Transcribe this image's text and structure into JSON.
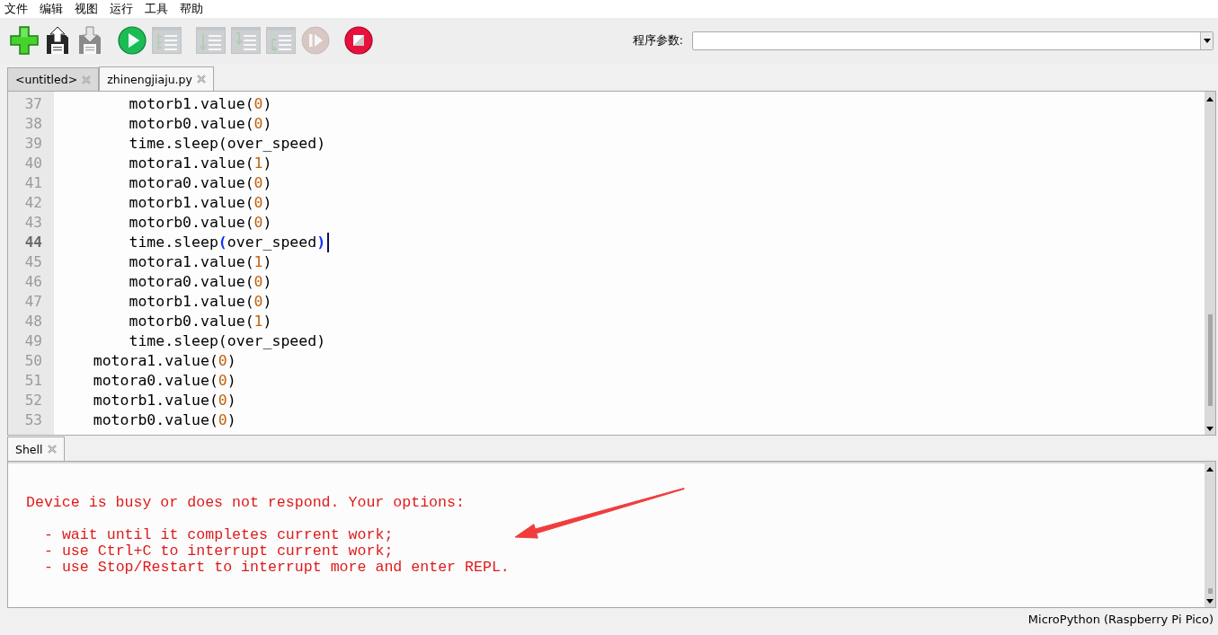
{
  "menu": [
    "文件",
    "编辑",
    "视图",
    "运行",
    "工具",
    "帮助"
  ],
  "toolbar": {
    "buttons": [
      {
        "kind": "new",
        "disabled": false
      },
      {
        "kind": "load",
        "disabled": false
      },
      {
        "kind": "save",
        "disabled": true
      },
      {
        "kind": "run",
        "disabled": false
      },
      {
        "kind": "debug",
        "disabled": true
      },
      {
        "kind": "step_over",
        "disabled": true
      },
      {
        "kind": "step_into",
        "disabled": true
      },
      {
        "kind": "step_out",
        "disabled": true
      },
      {
        "kind": "resume",
        "disabled": true
      },
      {
        "kind": "stop",
        "disabled": false
      }
    ],
    "program_args": {
      "label": "程序参数:"
    }
  },
  "editor_tabs": [
    {
      "label": "<untitled>",
      "selected": false
    },
    {
      "label": "zhinengjiaju.py",
      "selected": true
    }
  ],
  "editor": {
    "lines": [
      {
        "number": "37",
        "code": "        motorb1.value(0)",
        "current": false
      },
      {
        "number": "38",
        "code": "        motorb0.value(0)",
        "current": false
      },
      {
        "number": "39",
        "code": "        time.sleep(over_speed)",
        "current": false
      },
      {
        "number": "40",
        "code": "        motora1.value(1)",
        "current": false
      },
      {
        "number": "41",
        "code": "        motora0.value(0)",
        "current": false
      },
      {
        "number": "42",
        "code": "        motorb1.value(0)",
        "current": false
      },
      {
        "number": "43",
        "code": "        motorb0.value(0)",
        "current": false
      },
      {
        "number": "44",
        "code": "        time.sleep(over_speed)",
        "current": true
      },
      {
        "number": "45",
        "code": "        motora1.value(1)",
        "current": false
      },
      {
        "number": "46",
        "code": "        motora0.value(0)",
        "current": false
      },
      {
        "number": "47",
        "code": "        motorb1.value(0)",
        "current": false
      },
      {
        "number": "48",
        "code": "        motorb0.value(1)",
        "current": false
      },
      {
        "number": "49",
        "code": "        time.sleep(over_speed)",
        "current": false
      },
      {
        "number": "50",
        "code": "    motora1.value(0)",
        "current": false
      },
      {
        "number": "51",
        "code": "    motora0.value(0)",
        "current": false
      },
      {
        "number": "52",
        "code": "    motorb1.value(0)",
        "current": false
      },
      {
        "number": "53",
        "code": "    motorb0.value(0)",
        "current": false
      }
    ]
  },
  "shell": {
    "tab": {
      "label": "Shell",
      "selected": true
    },
    "message": "Device is busy or does not respond. Your options:",
    "options": [
      "- wait until it completes current work;",
      "- use Ctrl+C to interrupt current work;",
      "- use Stop/Restart to interrupt more and enter REPL."
    ]
  },
  "status_bar": {
    "backend": "MicroPython (Raspberry Pi Pico)"
  }
}
